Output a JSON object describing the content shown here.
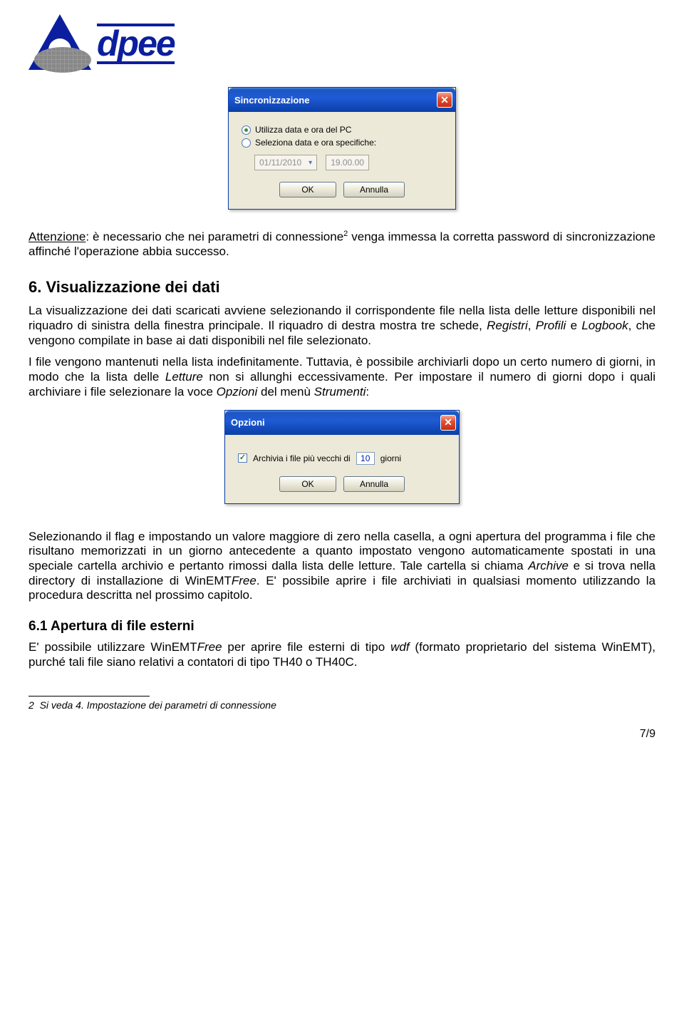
{
  "logo": {
    "text": "dpee"
  },
  "dialog_sync": {
    "title": "Sincronizzazione",
    "opt1": "Utilizza data e ora del PC",
    "opt2": "Seleziona data e ora specifiche:",
    "date": "01/11/2010",
    "time": "19.00.00",
    "ok": "OK",
    "cancel": "Annulla"
  },
  "warning": {
    "label": "Attenzione",
    "text": ": è necessario che nei parametri di connessione",
    "fn": "2",
    "text2": " venga immessa la corretta password di sincronizzazione affinché l'operazione abbia successo."
  },
  "section6": {
    "heading": "6. Visualizzazione dei dati",
    "p1": "La visualizzazione dei dati scaricati avviene selezionando il corrispondente file nella lista delle letture disponibili nel riquadro di sinistra della finestra principale. Il riquadro di destra mostra tre schede, ",
    "p1_i1": "Registri",
    "p1_m1": ", ",
    "p1_i2": "Profili",
    "p1_m2": " e ",
    "p1_i3": "Logbook",
    "p1_end": ", che vengono compilate in base ai dati disponibili nel file selezionato.",
    "p2a": "I file vengono mantenuti nella lista indefinitamente. Tuttavia, è possibile archiviarli dopo un certo numero di giorni, in modo che la lista delle ",
    "p2_i1": "Letture",
    "p2b": " non si allunghi eccessivamente. Per impostare il numero di giorni dopo i quali archiviare i file selezionare la voce ",
    "p2_i2": "Opzioni",
    "p2c": " del menù ",
    "p2_i3": "Strumenti",
    "p2d": ":"
  },
  "dialog_opt": {
    "title": "Opzioni",
    "chk_label": "Archivia i file più vecchi di",
    "value": "10",
    "unit": "giorni",
    "ok": "OK",
    "cancel": "Annulla"
  },
  "para3": {
    "a": "Selezionando il flag e impostando un valore maggiore di zero nella casella, a ogni apertura del programma i file che risultano memorizzati in un giorno antecedente a quanto impostato vengono automaticamente spostati in una speciale cartella archivio e pertanto rimossi dalla lista delle letture. Tale cartella  si chiama ",
    "i1": "Archive",
    "b": " e si trova nella directory di installazione di WinEMT",
    "i2": "Free",
    "c": ". E' possibile aprire i file archiviati in qualsiasi momento utilizzando la procedura descritta nel prossimo capitolo."
  },
  "section61": {
    "heading": "6.1 Apertura di file esterni",
    "a": "E' possibile utilizzare WinEMT",
    "i1": "Free",
    "b": " per aprire file esterni di tipo ",
    "i2": "wdf",
    "c": " (formato proprietario del sistema WinEMT), purché tali file siano relativi a contatori di tipo TH40 o TH40C."
  },
  "footnote": {
    "num": "2",
    "text": "Si veda 4. Impostazione dei parametri di connessione"
  },
  "page": "7/9"
}
